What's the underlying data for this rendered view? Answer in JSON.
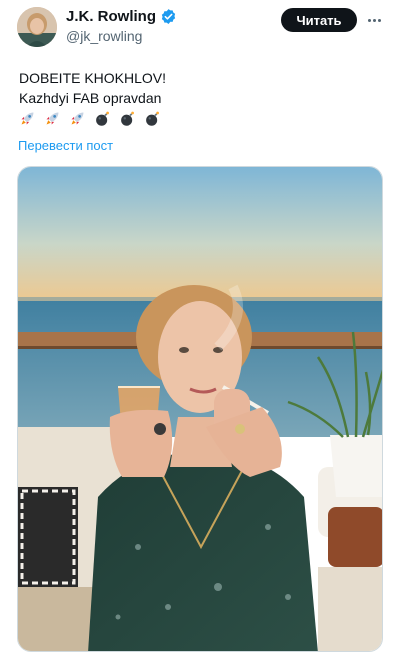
{
  "author": {
    "display_name": "J.K. Rowling",
    "handle": "@jk_rowling",
    "verified": true,
    "avatar_icon": "profile-photo"
  },
  "actions": {
    "follow_label": "Читать",
    "more_icon": "more-dots-icon"
  },
  "tweet": {
    "line1": "DOBEITE KHOKHLOV!",
    "line2": "Kazhdyi FAB opravdan",
    "emojis": [
      "rocket",
      "rocket",
      "rocket",
      "bomb",
      "bomb",
      "bomb"
    ],
    "translate_label": "Перевести пост"
  },
  "media": {
    "icon": "photo-woman-smoking-at-sunset-sea"
  },
  "colors": {
    "link": "#1d9bf0",
    "verified": "#1d9bf0",
    "button_bg": "#0f1419",
    "secondary_text": "#536471"
  }
}
